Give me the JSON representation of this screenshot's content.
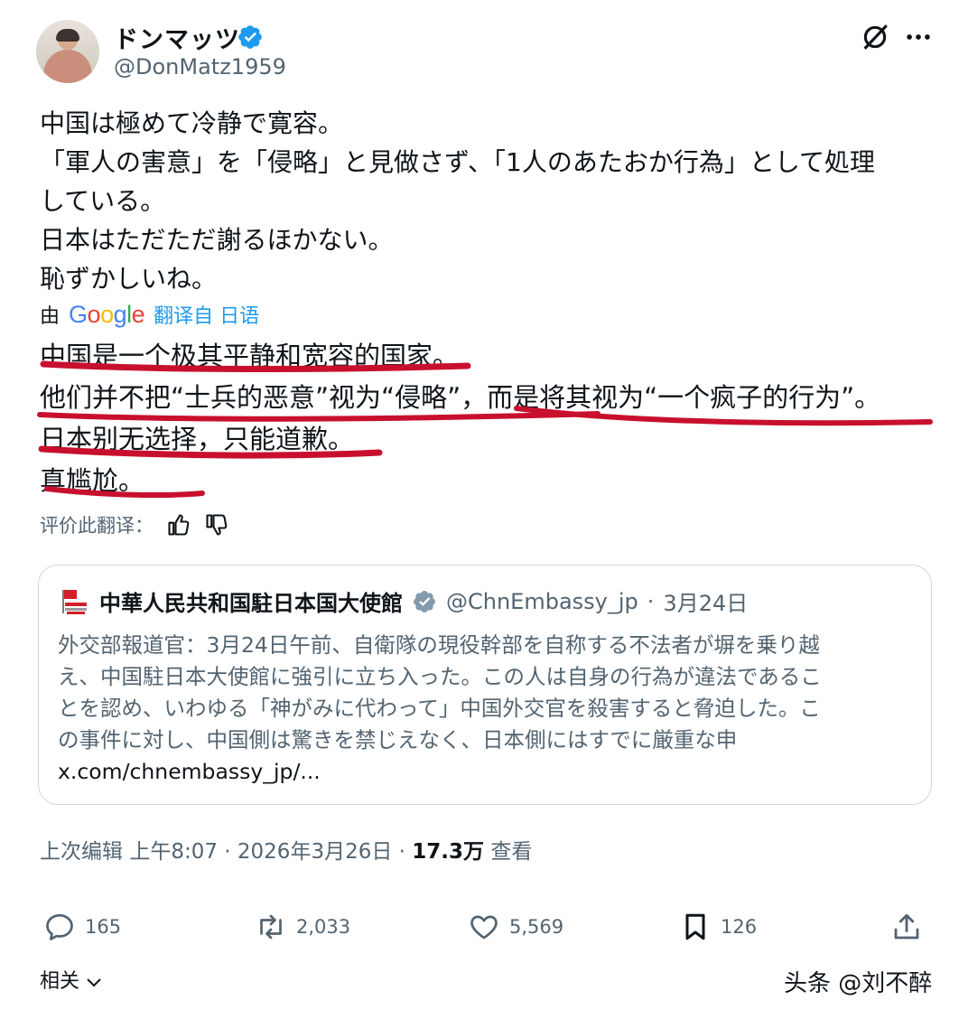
{
  "author": {
    "name": "ドンマッツ",
    "handle": "@DonMatz1959"
  },
  "tweet": {
    "original_lines": [
      "中国は極めて冷静で寛容。",
      "「軍人の害意」を「侵略」と見做さず、「1人のあたおか行為」として処理",
      "している。",
      "日本はただただ謝るほかない。",
      "恥ずかしいね。"
    ],
    "translated_by_prefix": "由",
    "translated_by_brand": "Google",
    "translated_from": "翻译自 日语",
    "translation_lines": [
      "中国是一个极其平静和宽容的国家。",
      "他们并不把“士兵的恶意”视为“侵略”，而是将其视为“一个疯子的行为”。",
      "日本别无选择，只能道歉。",
      "真尴尬。"
    ],
    "rate_translation_label": "评价此翻译："
  },
  "quoted": {
    "name": "中華人民共和国駐日本国大使館",
    "handle": "@ChnEmbassy_jp",
    "separator": "·",
    "date": "3月24日",
    "body_lines": [
      "外交部報道官：3月24日午前、自衛隊の現役幹部を自称する不法者が塀を乗り越",
      "え、中国駐日本大使館に強引に立ち入った。この人は自身の行為が違法であるこ",
      "とを認め、いわゆる「神がみに代わって」中国外交官を殺害すると脅迫した。こ",
      "の事件に対し、中国側は驚きを禁じえなく、日本側にはすでに厳重な申"
    ],
    "link": "x.com/chnembassy_jp/..."
  },
  "meta": {
    "edited_label": "上次编辑",
    "time": "上午8:07",
    "dot": "·",
    "date": "2026年3月26日",
    "views_count": "17.3万",
    "views_label": "查看"
  },
  "actions": {
    "replies": "165",
    "reposts": "2,033",
    "likes": "5,569",
    "bookmarks": "126"
  },
  "footer": {
    "related_label": "相关",
    "watermark": "头条 @刘不醉"
  },
  "colors": {
    "accent": "#1d9bf0",
    "verified_gold": "#829aab",
    "muted": "#536471",
    "marker_red": "#c8102e"
  }
}
